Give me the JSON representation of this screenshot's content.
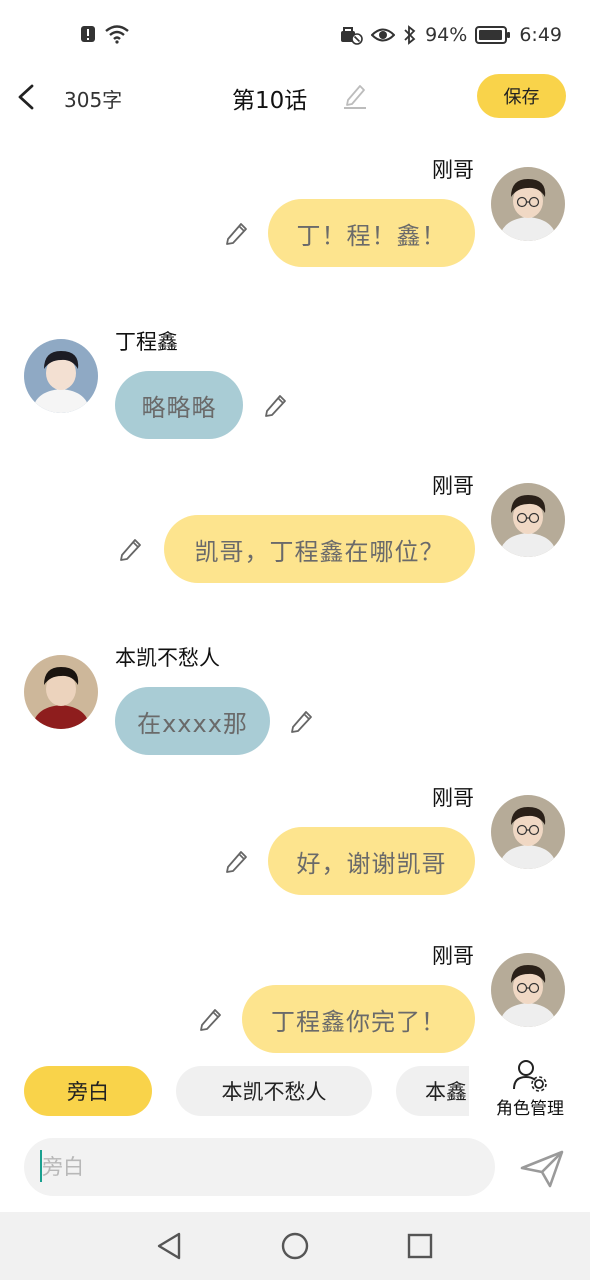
{
  "status_bar": {
    "battery": "94%",
    "time": "6:49",
    "icons": [
      "alert-icon",
      "wifi-icon",
      "vpn-icon",
      "eye-icon",
      "bluetooth-icon",
      "battery-icon"
    ]
  },
  "header": {
    "word_count": "305字",
    "title": "第10话",
    "save_label": "保存"
  },
  "messages": [
    {
      "sender": "刚哥",
      "side": "right",
      "text": "丁！程！鑫！"
    },
    {
      "sender": "丁程鑫",
      "side": "left",
      "text": "略略略"
    },
    {
      "sender": "刚哥",
      "side": "right",
      "text": "凯哥，丁程鑫在哪位？"
    },
    {
      "sender": "本凯不愁人",
      "side": "left",
      "text": "在xxxx那"
    },
    {
      "sender": "刚哥",
      "side": "right",
      "text": "好，谢谢凯哥"
    },
    {
      "sender": "刚哥",
      "side": "right",
      "text": "丁程鑫你完了！"
    }
  ],
  "roles": {
    "chips": [
      "旁白",
      "本凯不愁人",
      "本鑫"
    ],
    "active": "旁白",
    "manage_label": "角色管理"
  },
  "input": {
    "placeholder": "旁白",
    "value": ""
  },
  "colors": {
    "accent": "#f9d34a",
    "bubble_self": "#fde48e",
    "bubble_other": "#a9ccd5",
    "cursor": "#1aa08f"
  }
}
